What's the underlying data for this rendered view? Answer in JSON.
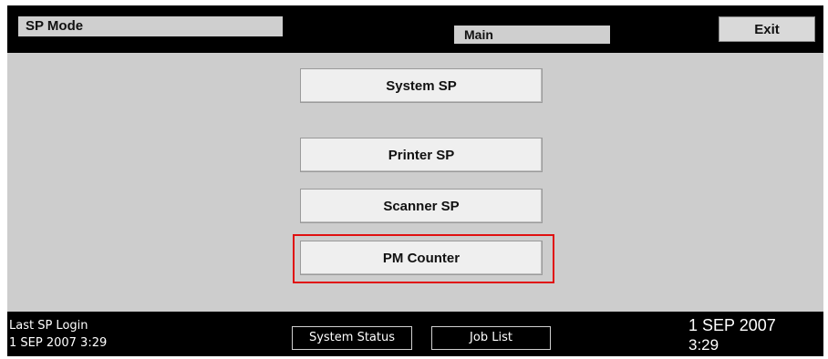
{
  "header": {
    "title": "SP Mode",
    "screen_label": "Main",
    "exit_label": "Exit"
  },
  "menu": {
    "items": [
      {
        "label": "System SP"
      },
      {
        "label": "Printer SP"
      },
      {
        "label": "Scanner SP"
      },
      {
        "label": "PM Counter"
      }
    ]
  },
  "footer": {
    "last_login_label": "Last SP Login",
    "last_login_value": "1 SEP 2007 3:29",
    "system_status_label": "System Status",
    "job_list_label": "Job List",
    "clock_date": "1 SEP 2007",
    "clock_time": "3:29"
  },
  "colors": {
    "background": "#000000",
    "panel": "#cdcdcd",
    "button": "#efefef",
    "highlight": "#e01010"
  }
}
